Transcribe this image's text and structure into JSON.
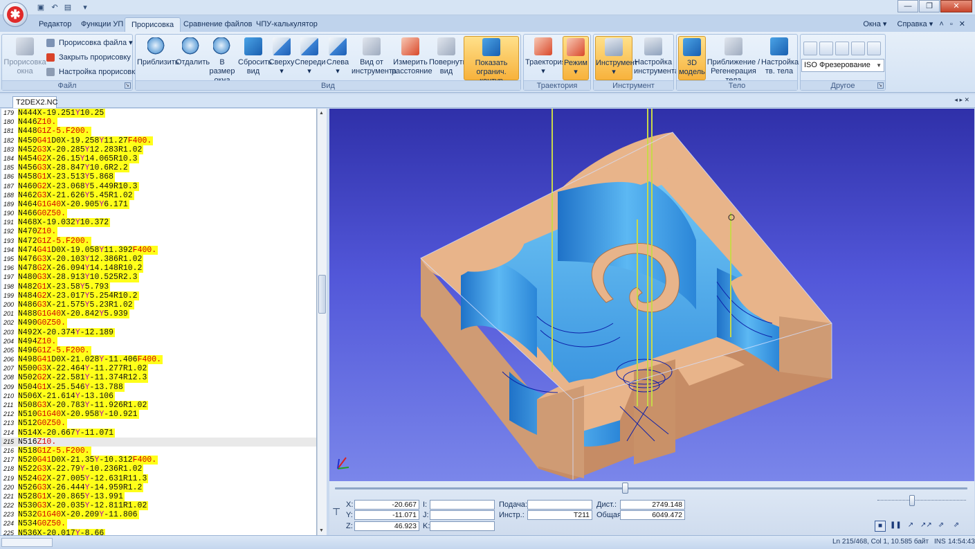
{
  "ribbon_tabs": [
    "Редактор",
    "Функции УП",
    "Прорисовка",
    "Сравнение файлов",
    "ЧПУ-калькулятор"
  ],
  "right_menu": {
    "windows": "Окна",
    "help": "Справка"
  },
  "file_group": {
    "big_button": "Прорисовка окна",
    "item1": "Прорисовка файла",
    "item2": "Закрыть прорисовку",
    "item3": "Настройка прорисовки",
    "label": "Файл"
  },
  "view_group": {
    "buttons": [
      "Приблизить",
      "Отдалить",
      "В размер окна",
      "Сбросить вид",
      "Сверху",
      "Спереди",
      "Слева",
      "Вид от инструмента",
      "Измерить расстояние",
      "Повернуть вид",
      "Показать огранич. контур"
    ],
    "label": "Вид"
  },
  "traj_group": {
    "buttons": [
      "Траектория",
      "Режим"
    ],
    "label": "Траектория"
  },
  "tool_group": {
    "buttons": [
      "Инструмент",
      "Настройка инструмента"
    ],
    "label": "Инструмент"
  },
  "body_group": {
    "buttons": [
      "3D модель",
      "Приближение / Регенерация тела",
      "Настройка тв. тела"
    ],
    "label": "Тело"
  },
  "other_group": {
    "select": "ISO Фрезерование",
    "label": "Другое"
  },
  "document_tab": "T2DEX2.NC",
  "code_lines": [
    {
      "n": "179",
      "p": [
        [
          "n",
          "N444"
        ],
        [
          "xs",
          "X-19.251"
        ],
        [
          "y",
          "Y"
        ],
        [
          "xs",
          "10.25"
        ]
      ]
    },
    {
      "n": "180",
      "p": [
        [
          "n",
          "N446"
        ],
        [
          "z",
          "Z10."
        ]
      ]
    },
    {
      "n": "181",
      "p": [
        [
          "n",
          "N448"
        ],
        [
          "g",
          "G1"
        ],
        [
          "z",
          "Z-5."
        ],
        [
          "f",
          "F200."
        ]
      ]
    },
    {
      "n": "182",
      "p": [
        [
          "n",
          "N450"
        ],
        [
          "g",
          "G41"
        ],
        [
          "xs",
          "D0X-19.258"
        ],
        [
          "y",
          "Y"
        ],
        [
          "xs",
          "11.27"
        ],
        [
          "f",
          "F400."
        ]
      ]
    },
    {
      "n": "183",
      "p": [
        [
          "n",
          "N452"
        ],
        [
          "g",
          "G3"
        ],
        [
          "xs",
          "X-20.285"
        ],
        [
          "y",
          "Y"
        ],
        [
          "xs",
          "12.283R1.02"
        ]
      ]
    },
    {
      "n": "184",
      "p": [
        [
          "n",
          "N454"
        ],
        [
          "g",
          "G2"
        ],
        [
          "xs",
          "X-26.15"
        ],
        [
          "y",
          "Y"
        ],
        [
          "xs",
          "14.065R10.3"
        ]
      ]
    },
    {
      "n": "185",
      "p": [
        [
          "n",
          "N456"
        ],
        [
          "g",
          "G3"
        ],
        [
          "xs",
          "X-28.847"
        ],
        [
          "y",
          "Y"
        ],
        [
          "xs",
          "10.6R2.2"
        ]
      ]
    },
    {
      "n": "186",
      "p": [
        [
          "n",
          "N458"
        ],
        [
          "g",
          "G1"
        ],
        [
          "xs",
          "X-23.513"
        ],
        [
          "y",
          "Y"
        ],
        [
          "xs",
          "5.868"
        ]
      ]
    },
    {
      "n": "187",
      "p": [
        [
          "n",
          "N460"
        ],
        [
          "g",
          "G2"
        ],
        [
          "xs",
          "X-23.068"
        ],
        [
          "y",
          "Y"
        ],
        [
          "xs",
          "5.449R10.3"
        ]
      ]
    },
    {
      "n": "188",
      "p": [
        [
          "n",
          "N462"
        ],
        [
          "g",
          "G3"
        ],
        [
          "xs",
          "X-21.626"
        ],
        [
          "y",
          "Y"
        ],
        [
          "xs",
          "5.45R1.02"
        ]
      ]
    },
    {
      "n": "189",
      "p": [
        [
          "n",
          "N464"
        ],
        [
          "g",
          "G1G40"
        ],
        [
          "xs",
          "X-20.905"
        ],
        [
          "y",
          "Y"
        ],
        [
          "xs",
          "6.171"
        ]
      ]
    },
    {
      "n": "190",
      "p": [
        [
          "n",
          "N466"
        ],
        [
          "g",
          "G0"
        ],
        [
          "z",
          "Z50."
        ]
      ]
    },
    {
      "n": "191",
      "p": [
        [
          "n",
          "N468"
        ],
        [
          "xs",
          "X-19.032"
        ],
        [
          "y",
          "Y"
        ],
        [
          "xs",
          "10.372"
        ]
      ]
    },
    {
      "n": "192",
      "p": [
        [
          "n",
          "N470"
        ],
        [
          "z",
          "Z10."
        ]
      ]
    },
    {
      "n": "193",
      "p": [
        [
          "n",
          "N472"
        ],
        [
          "g",
          "G1"
        ],
        [
          "z",
          "Z-5."
        ],
        [
          "f",
          "F200."
        ]
      ]
    },
    {
      "n": "194",
      "p": [
        [
          "n",
          "N474"
        ],
        [
          "g",
          "G41"
        ],
        [
          "xs",
          "D0X-19.058"
        ],
        [
          "y",
          "Y"
        ],
        [
          "xs",
          "11.392"
        ],
        [
          "f",
          "F400."
        ]
      ]
    },
    {
      "n": "195",
      "p": [
        [
          "n",
          "N476"
        ],
        [
          "g",
          "G3"
        ],
        [
          "xs",
          "X-20.103"
        ],
        [
          "y",
          "Y"
        ],
        [
          "xs",
          "12.386R1.02"
        ]
      ]
    },
    {
      "n": "196",
      "p": [
        [
          "n",
          "N478"
        ],
        [
          "g",
          "G2"
        ],
        [
          "xs",
          "X-26.094"
        ],
        [
          "y",
          "Y"
        ],
        [
          "xs",
          "14.148R10.2"
        ]
      ]
    },
    {
      "n": "197",
      "p": [
        [
          "n",
          "N480"
        ],
        [
          "g",
          "G3"
        ],
        [
          "xs",
          "X-28.913"
        ],
        [
          "y",
          "Y"
        ],
        [
          "xs",
          "10.525R2.3"
        ]
      ]
    },
    {
      "n": "198",
      "p": [
        [
          "n",
          "N482"
        ],
        [
          "g",
          "G1"
        ],
        [
          "xs",
          "X-23.58"
        ],
        [
          "y",
          "Y"
        ],
        [
          "xs",
          "5.793"
        ]
      ]
    },
    {
      "n": "199",
      "p": [
        [
          "n",
          "N484"
        ],
        [
          "g",
          "G2"
        ],
        [
          "xs",
          "X-23.017"
        ],
        [
          "y",
          "Y"
        ],
        [
          "xs",
          "5.254R10.2"
        ]
      ]
    },
    {
      "n": "200",
      "p": [
        [
          "n",
          "N486"
        ],
        [
          "g",
          "G3"
        ],
        [
          "xs",
          "X-21.575"
        ],
        [
          "y",
          "Y"
        ],
        [
          "xs",
          "5.23R1.02"
        ]
      ]
    },
    {
      "n": "201",
      "p": [
        [
          "n",
          "N488"
        ],
        [
          "g",
          "G1G40"
        ],
        [
          "xs",
          "X-20.842"
        ],
        [
          "y",
          "Y"
        ],
        [
          "xs",
          "5.939"
        ]
      ]
    },
    {
      "n": "202",
      "p": [
        [
          "n",
          "N490"
        ],
        [
          "g",
          "G0"
        ],
        [
          "z",
          "Z50."
        ]
      ]
    },
    {
      "n": "203",
      "p": [
        [
          "n",
          "N492"
        ],
        [
          "xs",
          "X-20.374"
        ],
        [
          "y",
          "Y"
        ],
        [
          "xs",
          "-12.189"
        ]
      ]
    },
    {
      "n": "204",
      "p": [
        [
          "n",
          "N494"
        ],
        [
          "z",
          "Z10."
        ]
      ]
    },
    {
      "n": "205",
      "p": [
        [
          "n",
          "N496"
        ],
        [
          "g",
          "G1"
        ],
        [
          "z",
          "Z-5."
        ],
        [
          "f",
          "F200."
        ]
      ]
    },
    {
      "n": "206",
      "p": [
        [
          "n",
          "N498"
        ],
        [
          "g",
          "G41"
        ],
        [
          "xs",
          "D0X-21.028"
        ],
        [
          "y",
          "Y"
        ],
        [
          "xs",
          "-11.406"
        ],
        [
          "f",
          "F400."
        ]
      ]
    },
    {
      "n": "207",
      "p": [
        [
          "n",
          "N500"
        ],
        [
          "g",
          "G3"
        ],
        [
          "xs",
          "X-22.464"
        ],
        [
          "y",
          "Y"
        ],
        [
          "xs",
          "-11.277R1.02"
        ]
      ]
    },
    {
      "n": "208",
      "p": [
        [
          "n",
          "N502"
        ],
        [
          "g",
          "G2"
        ],
        [
          "xs",
          "X-22.581"
        ],
        [
          "y",
          "Y"
        ],
        [
          "xs",
          "-11.374R12.3"
        ]
      ]
    },
    {
      "n": "209",
      "p": [
        [
          "n",
          "N504"
        ],
        [
          "g",
          "G1"
        ],
        [
          "xs",
          "X-25.546"
        ],
        [
          "y",
          "Y"
        ],
        [
          "xs",
          "-13.788"
        ]
      ]
    },
    {
      "n": "210",
      "p": [
        [
          "n",
          "N506"
        ],
        [
          "xs",
          "X-21.614"
        ],
        [
          "y",
          "Y"
        ],
        [
          "xs",
          "-13.106"
        ]
      ]
    },
    {
      "n": "211",
      "p": [
        [
          "n",
          "N508"
        ],
        [
          "g",
          "G3"
        ],
        [
          "xs",
          "X-20.783"
        ],
        [
          "y",
          "Y"
        ],
        [
          "xs",
          "-11.926R1.02"
        ]
      ]
    },
    {
      "n": "212",
      "p": [
        [
          "n",
          "N510"
        ],
        [
          "g",
          "G1G40"
        ],
        [
          "xs",
          "X-20.958"
        ],
        [
          "y",
          "Y"
        ],
        [
          "xs",
          "-10.921"
        ]
      ]
    },
    {
      "n": "213",
      "p": [
        [
          "n",
          "N512"
        ],
        [
          "g",
          "G0"
        ],
        [
          "z",
          "Z50."
        ]
      ]
    },
    {
      "n": "214",
      "p": [
        [
          "n",
          "N514"
        ],
        [
          "xs",
          "X-20.667"
        ],
        [
          "y",
          "Y"
        ],
        [
          "xs",
          "-11.071"
        ]
      ]
    },
    {
      "n": "215",
      "cur": true,
      "p": [
        [
          "n",
          "N516"
        ],
        [
          "z",
          "Z10."
        ]
      ]
    },
    {
      "n": "216",
      "p": [
        [
          "n",
          "N518"
        ],
        [
          "g",
          "G1"
        ],
        [
          "z",
          "Z-5."
        ],
        [
          "f",
          "F200."
        ]
      ]
    },
    {
      "n": "217",
      "p": [
        [
          "n",
          "N520"
        ],
        [
          "g",
          "G41"
        ],
        [
          "xs",
          "D0X-21.35"
        ],
        [
          "y",
          "Y"
        ],
        [
          "xs",
          "-10.312"
        ],
        [
          "f",
          "F400."
        ]
      ]
    },
    {
      "n": "218",
      "p": [
        [
          "n",
          "N522"
        ],
        [
          "g",
          "G3"
        ],
        [
          "xs",
          "X-22.79"
        ],
        [
          "y",
          "Y"
        ],
        [
          "xs",
          "-10.236R1.02"
        ]
      ]
    },
    {
      "n": "219",
      "p": [
        [
          "n",
          "N524"
        ],
        [
          "g",
          "G2"
        ],
        [
          "xs",
          "X-27.005"
        ],
        [
          "y",
          "Y"
        ],
        [
          "xs",
          "-12.631R11.3"
        ]
      ]
    },
    {
      "n": "220",
      "p": [
        [
          "n",
          "N526"
        ],
        [
          "g",
          "G3"
        ],
        [
          "xs",
          "X-26.444"
        ],
        [
          "y",
          "Y"
        ],
        [
          "xs",
          "-14.959R1.2"
        ]
      ]
    },
    {
      "n": "221",
      "p": [
        [
          "n",
          "N528"
        ],
        [
          "g",
          "G1"
        ],
        [
          "xs",
          "X-20.865"
        ],
        [
          "y",
          "Y"
        ],
        [
          "xs",
          "-13.991"
        ]
      ]
    },
    {
      "n": "222",
      "p": [
        [
          "n",
          "N530"
        ],
        [
          "g",
          "G3"
        ],
        [
          "xs",
          "X-20.035"
        ],
        [
          "y",
          "Y"
        ],
        [
          "xs",
          "-12.811R1.02"
        ]
      ]
    },
    {
      "n": "223",
      "p": [
        [
          "n",
          "N532"
        ],
        [
          "g",
          "G1G40"
        ],
        [
          "xs",
          "X-20.209"
        ],
        [
          "y",
          "Y"
        ],
        [
          "xs",
          "-11.806"
        ]
      ]
    },
    {
      "n": "224",
      "p": [
        [
          "n",
          "N534"
        ],
        [
          "g",
          "G0"
        ],
        [
          "z",
          "Z50."
        ]
      ]
    },
    {
      "n": "225",
      "p": [
        [
          "n",
          "N536"
        ],
        [
          "xs",
          "X-20.017"
        ],
        [
          "y",
          "Y"
        ],
        [
          "xs",
          "-8.66"
        ]
      ]
    }
  ],
  "coords": {
    "x_label": "X:",
    "x": "-20.667",
    "y_label": "Y:",
    "y": "-11.071",
    "z_label": "Z:",
    "z": "46.923",
    "i_label": "I:",
    "i": "",
    "j_label": "J:",
    "j": "",
    "k_label": "K:",
    "k": "",
    "feed_label": "Подача:",
    "feed": "",
    "tool_label": "Инстр.:",
    "tool": "T211",
    "dist_label": "Дист.:",
    "dist": "2749.148",
    "total_label": "Общая:",
    "total": "6049.472"
  },
  "status": {
    "position": "Ln 215/468, Col 1, 10.585 байт",
    "mode": "INS",
    "time": "14:54:43"
  },
  "colors": {
    "block_top": "#e8b48a",
    "pocket": "#3f9fe8",
    "background": "#4d52d0",
    "highlight": "#ffff1a"
  }
}
